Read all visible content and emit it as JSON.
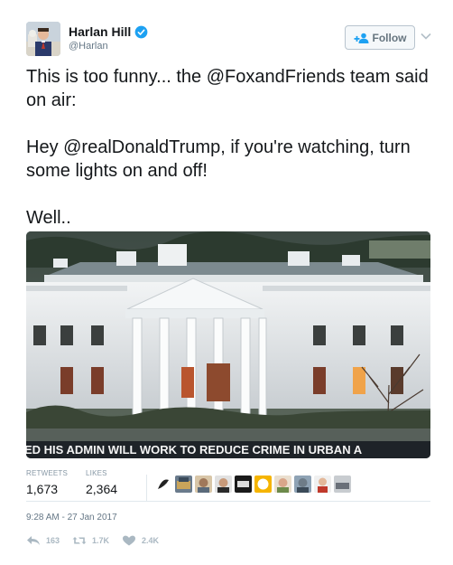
{
  "user": {
    "name": "Harlan Hill",
    "handle": "@Harlan"
  },
  "follow_label": "Follow",
  "text": {
    "line1_prefix": "This is too funny... the ",
    "line1_mention": "@FoxandFriends",
    "line1_suffix": " team said on air:",
    "line2_prefix": "Hey ",
    "line2_mention": "@realDonaldTrump",
    "line2_suffix": ", if you're watching, turn some lights on and off!",
    "line3": "Well.."
  },
  "media": {
    "ticker_text": "ED HIS ADMIN WILL WORK TO REDUCE CRIME IN URBAN A"
  },
  "stats": {
    "retweets_label": "RETWEETS",
    "retweets_value": "1,673",
    "likes_label": "LIKES",
    "likes_value": "2,364"
  },
  "timestamp": "9:28 AM - 27 Jan 2017",
  "actions": {
    "reply_count": "163",
    "retweet_count": "1.7K",
    "like_count": "2.4K"
  },
  "colors": {
    "verified": "#1da1f2",
    "text": "#14171a",
    "muted": "#657786",
    "action": "#aab8c2"
  },
  "icons": [
    "verified-badge-icon",
    "follow-person-icon",
    "chevron-down-icon",
    "reply-icon",
    "retweet-icon",
    "heart-icon"
  ]
}
